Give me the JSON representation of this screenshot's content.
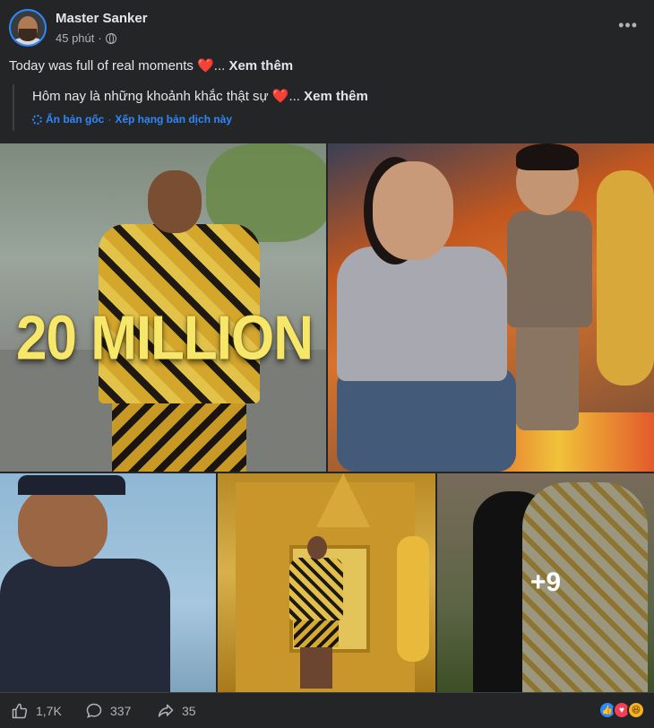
{
  "post": {
    "author": "Master Sanker",
    "time": "45 phút",
    "more_label": "•••",
    "caption": "Today was full of real moments ",
    "caption_ellipsis": "... ",
    "see_more": "Xem thêm",
    "heart": "❤️",
    "translation": {
      "text": "Hôm nay là những khoảnh khắc thật sự ",
      "ellipsis": "... ",
      "see_more": "Xem thêm",
      "hide_original": "Ẩn bản gốc",
      "separator": "·",
      "rate": "Xếp hạng bản dịch này"
    },
    "photo1_overlay": "20 MILLION",
    "extra_photos": "+9"
  },
  "footer": {
    "likes": "1,7K",
    "comments": "337",
    "shares": "35"
  },
  "colors": {
    "background": "#242526",
    "text": "#e4e6eb",
    "secondary": "#b0b3b8",
    "accent": "#2d88ff"
  }
}
